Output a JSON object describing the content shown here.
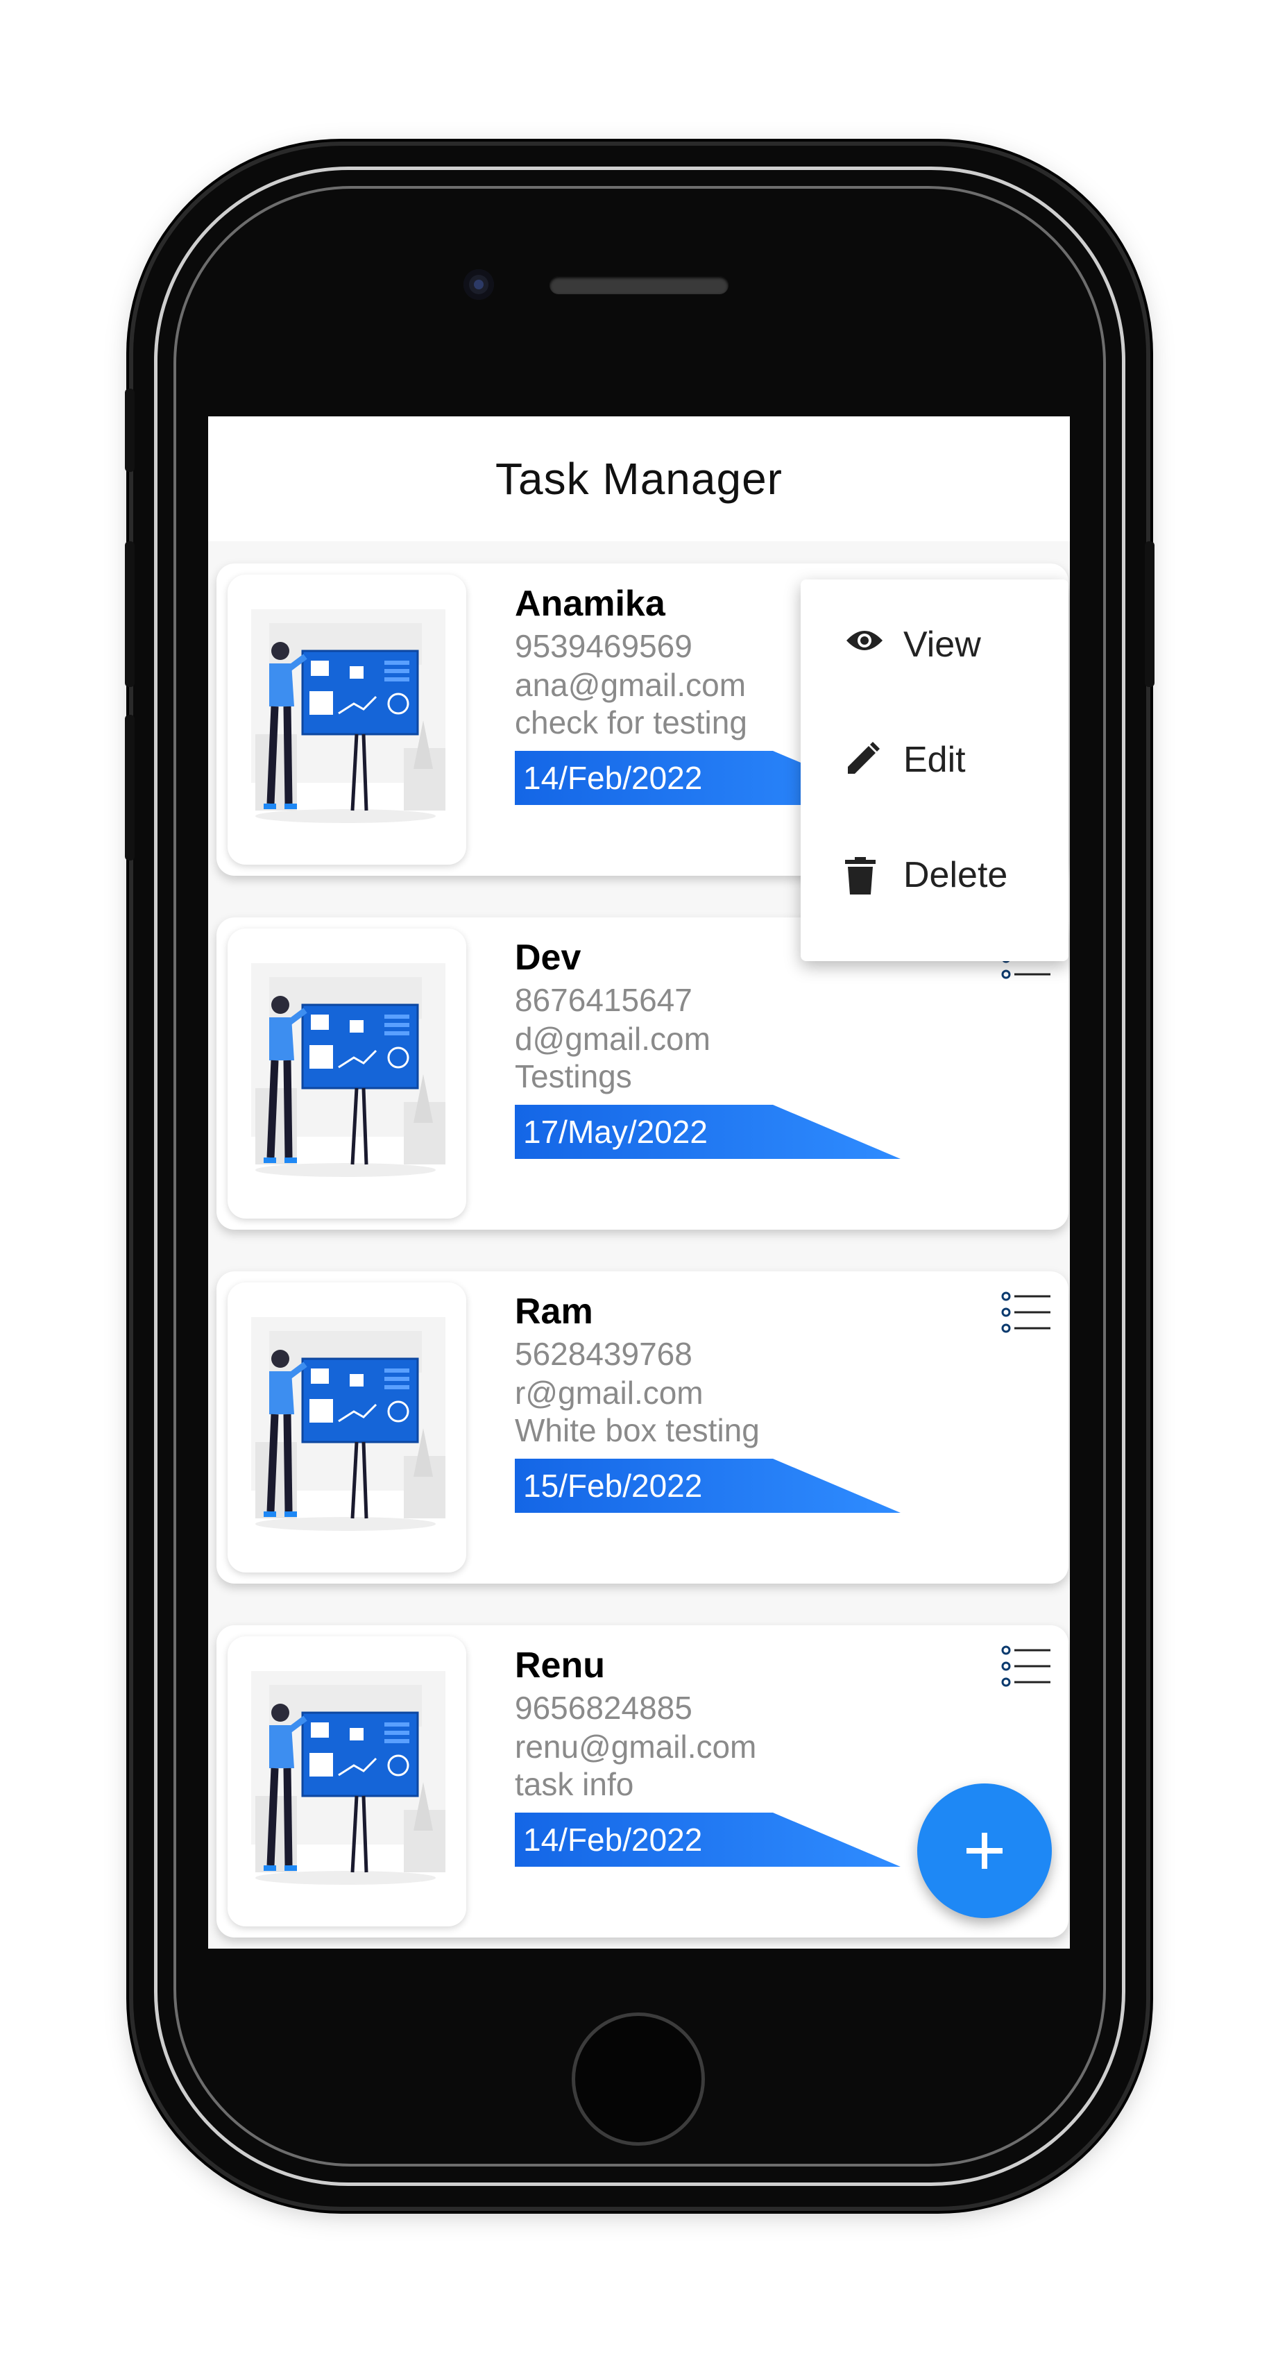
{
  "app": {
    "title": "Task Manager"
  },
  "colors": {
    "accent": "#1e88f5",
    "fab": "#1e88f5",
    "muted_text": "#8a8a8a"
  },
  "tasks": [
    {
      "name": "Anamika",
      "phone": "9539469569",
      "email": "ana@gmail.com",
      "description": "check for testing",
      "date": "14/Feb/2022"
    },
    {
      "name": "Dev",
      "phone": "8676415647",
      "email": "d@gmail.com",
      "description": "Testings",
      "date": "17/May/2022"
    },
    {
      "name": "Ram",
      "phone": "5628439768",
      "email": "r@gmail.com",
      "description": "White box testing",
      "date": "15/Feb/2022"
    },
    {
      "name": "Renu",
      "phone": "9656824885",
      "email": "renu@gmail.com",
      "description": "task info",
      "date": "14/Feb/2022"
    }
  ],
  "popup_menu": {
    "items": [
      {
        "label": "View",
        "icon": "eye-icon"
      },
      {
        "label": "Edit",
        "icon": "pencil-icon"
      },
      {
        "label": "Delete",
        "icon": "trash-icon"
      }
    ]
  },
  "fab": {
    "icon": "plus-icon"
  }
}
